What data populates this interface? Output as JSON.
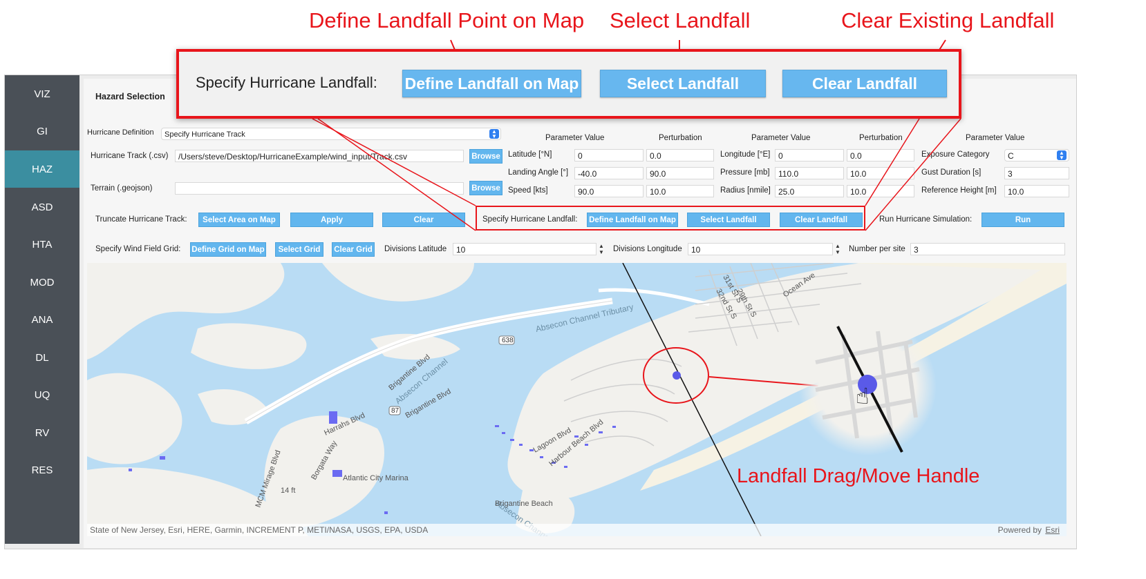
{
  "annotations": {
    "define_landfall_point": "Define Landfall Point on Map",
    "select_landfall": "Select Landfall",
    "clear_existing_landfall": "Clear Existing Landfall",
    "drag_handle": "Landfall Drag/Move Handle"
  },
  "callout": {
    "label": "Specify Hurricane Landfall:",
    "define_button": "Define Landfall on Map",
    "select_button": "Select Landfall",
    "clear_button": "Clear Landfall"
  },
  "sidebar": {
    "items": [
      {
        "label": "VIZ"
      },
      {
        "label": "GI"
      },
      {
        "label": "HAZ"
      },
      {
        "label": "ASD"
      },
      {
        "label": "HTA"
      },
      {
        "label": "MOD"
      },
      {
        "label": "ANA"
      },
      {
        "label": "DL"
      },
      {
        "label": "UQ"
      },
      {
        "label": "RV"
      },
      {
        "label": "RES"
      }
    ],
    "active": "HAZ"
  },
  "header": {
    "tab": "Hazard Selection"
  },
  "form": {
    "hurricane_definition_label": "Hurricane Definition",
    "hurricane_definition_value": "Specify Hurricane Track",
    "track_label": "Hurricane Track (.csv)",
    "track_value": "/Users/steve/Desktop/HurricaneExample/wind_input/Track.csv",
    "terrain_label": "Terrain (.geojson)",
    "terrain_value": "",
    "browse": "Browse",
    "truncate_label": "Truncate Hurricane Track:",
    "select_area": "Select Area on Map",
    "apply": "Apply",
    "clear": "Clear",
    "landfall_label": "Specify Hurricane Landfall:",
    "define_landfall": "Define Landfall on Map",
    "select_landfall": "Select Landfall",
    "clear_landfall": "Clear Landfall",
    "run_label": "Run Hurricane Simulation:",
    "run": "Run",
    "grid_label": "Specify Wind Field Grid:",
    "define_grid": "Define Grid on Map",
    "select_grid": "Select Grid",
    "clear_grid": "Clear Grid",
    "div_lat_label": "Divisions Latitude",
    "div_lat_value": "10",
    "div_lon_label": "Divisions Longitude",
    "div_lon_value": "10",
    "per_site_label": "Number per site",
    "per_site_value": "3"
  },
  "params": {
    "header_param_value": "Parameter Value",
    "header_perturbation": "Perturbation",
    "latitude_label": "Latitude [°N]",
    "latitude_value": "0",
    "latitude_pert": "0.0",
    "landing_label": "Landing Angle [°]",
    "landing_value": "-40.0",
    "landing_pert": "90.0",
    "speed_label": "Speed [kts]",
    "speed_value": "90.0",
    "speed_pert": "10.0",
    "longitude_label": "Longitude [°E]",
    "longitude_value": "0",
    "longitude_pert": "0.0",
    "pressure_label": "Pressure [mb]",
    "pressure_value": "110.0",
    "pressure_pert": "10.0",
    "radius_label": "Radius [nmile]",
    "radius_value": "25.0",
    "radius_pert": "10.0",
    "exposure_label": "Exposure Category",
    "exposure_value": "C",
    "gust_label": "Gust Duration [s]",
    "gust_value": "3",
    "refheight_label": "Reference Height [m]",
    "refheight_value": "10.0"
  },
  "map": {
    "labels": {
      "channel": "Absecon Channel Tributary",
      "brigantine_blvd1": "Brigantine Blvd",
      "brigantine_blvd2": "Brigantine Blvd",
      "route638": "638",
      "route87": "87",
      "harrahs": "Harrahs Blvd",
      "borgata": "Borgata Way",
      "mcm": "MCM Mirage Blvd",
      "marina": "Atlantic City Marina",
      "lagoon": "Lagoon Blvd",
      "harbour": "Harbour Beach Blvd",
      "absecon_channel": "Absecon Channel",
      "brigantine_beach": "Brigantine Beach",
      "st29": "29th St S",
      "st31": "31st St S",
      "st32": "32nd St S",
      "ocean_ave": "Ocean Ave",
      "ft14": "14 ft"
    },
    "attribution": "State of New Jersey, Esri, HERE, Garmin, INCREMENT P, METI/NASA, USGS, EPA, USDA",
    "powered_by": "Powered by",
    "esri": "Esri"
  },
  "colors": {
    "annotation_red": "#e8151b",
    "button_blue": "#62b6ee",
    "sidebar": "#4a5057",
    "sidebar_active": "#3b8ea0",
    "water": "#b9dcf4",
    "land": "#f2f1ed"
  }
}
